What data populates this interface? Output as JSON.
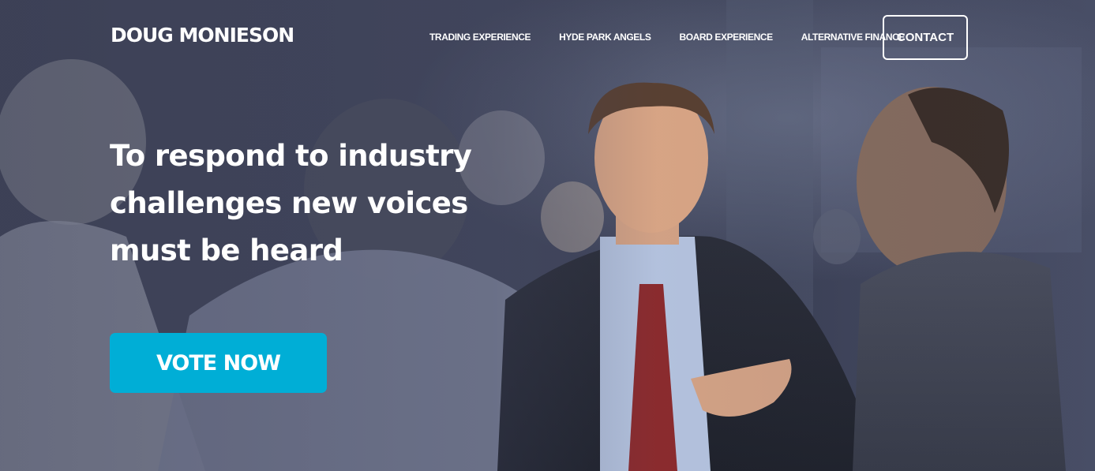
{
  "brand": {
    "name": "DOUG MONIESON"
  },
  "nav": {
    "items": [
      {
        "label": "TRADING EXPERIENCE"
      },
      {
        "label": "HYDE PARK ANGELS"
      },
      {
        "label": "BOARD EXPERIENCE"
      },
      {
        "label": "ALTERNATIVE FINANCE"
      }
    ],
    "contact_label": "CONTACT"
  },
  "hero": {
    "headline_lines": [
      "To respond to industry",
      "challenges new voices",
      "must be heard"
    ],
    "cta_label": "VOTE NOW"
  },
  "colors": {
    "cta": "#00aed6",
    "overlay": "#3e425a",
    "text": "#ffffff"
  }
}
